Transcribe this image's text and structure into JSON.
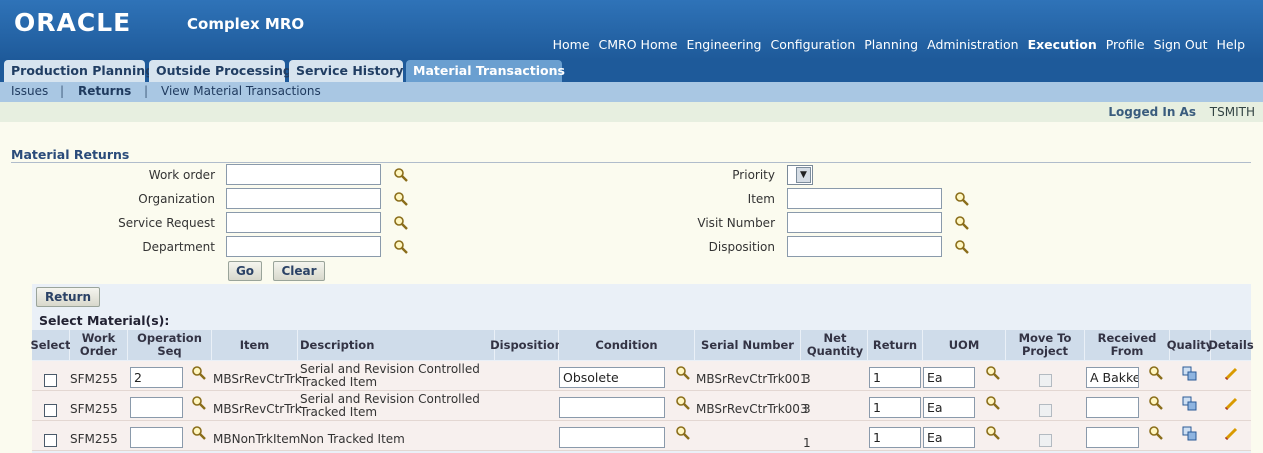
{
  "header": {
    "logo": "ORACLE",
    "app_name": "Complex MRO",
    "global_nav": [
      "Home",
      "CMRO Home",
      "Engineering",
      "Configuration",
      "Planning",
      "Administration",
      "Execution",
      "Profile",
      "Sign Out",
      "Help"
    ],
    "active_nav": "Execution"
  },
  "tabs": [
    "Production Planning",
    "Outside Processing",
    "Service History",
    "Material Transactions"
  ],
  "subtabs": [
    "Issues",
    "Returns",
    "View Material Transactions"
  ],
  "logged_in": {
    "label": "Logged In As",
    "user": "TSMITH"
  },
  "section_title": "Material Returns",
  "search": {
    "left_fields": [
      "Work order",
      "Organization",
      "Service Request",
      "Department"
    ],
    "right_fields": [
      "Priority",
      "Item",
      "Visit Number",
      "Disposition"
    ],
    "go": "Go",
    "clear": "Clear"
  },
  "table": {
    "return_button": "Return",
    "title": "Select Material(s):",
    "headers": [
      "Select",
      "Work Order",
      "Operation Seq",
      "Item",
      "Description",
      "Disposition",
      "Condition",
      "Serial Number",
      "Net Quantity",
      "Return",
      "UOM",
      "Move To Project",
      "Received From",
      "Quality",
      "Details"
    ],
    "rows": [
      {
        "work_order": "SFM255",
        "op_seq": "2",
        "item": "MBSrRevCtrTrk",
        "description": "Serial and Revision Controlled Tracked Item",
        "disposition": "",
        "condition": "Obsolete",
        "serial": "MBSrRevCtrTrk001",
        "net_qty": "3",
        "return": "1",
        "uom": "Ea",
        "received_from": "A Bakker"
      },
      {
        "work_order": "SFM255",
        "op_seq": "",
        "item": "MBSrRevCtrTrk",
        "description": "Serial and Revision Controlled Tracked Item",
        "disposition": "",
        "condition": "",
        "serial": "MBSrRevCtrTrk003",
        "net_qty": "3",
        "return": "1",
        "uom": "Ea",
        "received_from": ""
      },
      {
        "work_order": "SFM255",
        "op_seq": "",
        "item": "MBNonTrkItem",
        "description": "Non Tracked Item",
        "disposition": "",
        "condition": "",
        "serial": "",
        "net_qty": "1",
        "return": "1",
        "uom": "Ea",
        "received_from": ""
      }
    ]
  },
  "colors": {
    "header_blue": "#2f73b8",
    "tab_selected": "#6a9fd0",
    "subbar": "#a9c7e3",
    "page_bg": "#fbfbef"
  }
}
